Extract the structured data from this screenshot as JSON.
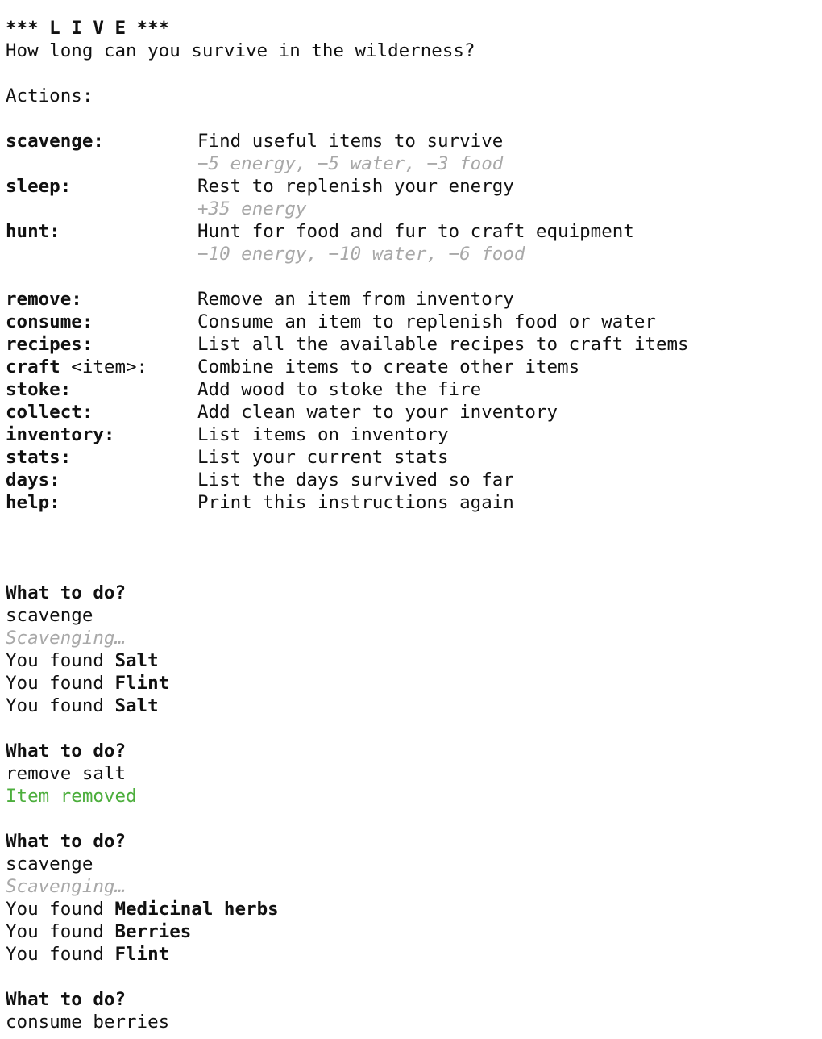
{
  "header": {
    "title": "*** L I V E ***",
    "subtitle": "How long can you survive in the wilderness?",
    "actions_label": "Actions:"
  },
  "actions_primary": [
    {
      "command": "scavenge:",
      "arg": "",
      "description": "Find useful items to survive",
      "cost": "−5 energy, −5 water, −3 food"
    },
    {
      "command": "sleep:",
      "arg": "",
      "description": "Rest to replenish your energy",
      "cost": "+35 energy"
    },
    {
      "command": "hunt:",
      "arg": "",
      "description": "Hunt for food and fur to craft equipment",
      "cost": "−10 energy, −10 water, −6 food"
    }
  ],
  "actions_secondary": [
    {
      "command": "remove:",
      "arg": "",
      "description": "Remove an item from inventory"
    },
    {
      "command": "consume:",
      "arg": "",
      "description": "Consume an item to replenish food or water"
    },
    {
      "command": "recipes:",
      "arg": "",
      "description": "List all the available recipes to craft items"
    },
    {
      "command": "craft",
      "arg": " <item>:",
      "description": "Combine items to create other items"
    },
    {
      "command": "stoke:",
      "arg": "",
      "description": "Add wood to stoke the fire"
    },
    {
      "command": "collect:",
      "arg": "",
      "description": "Add clean water to your inventory"
    },
    {
      "command": "inventory:",
      "arg": "",
      "description": "List items on inventory"
    },
    {
      "command": "stats:",
      "arg": "",
      "description": "List your current stats"
    },
    {
      "command": "days:",
      "arg": "",
      "description": "List the days survived so far"
    },
    {
      "command": "help:",
      "arg": "",
      "description": "Print this instructions again"
    }
  ],
  "log": {
    "prompt": "What to do?",
    "found_prefix": "You found ",
    "turns": [
      {
        "input": "scavenge",
        "status": "Scavenging…",
        "found": [
          "Salt",
          "Flint",
          "Salt"
        ]
      },
      {
        "input": "remove salt",
        "result": "Item removed"
      },
      {
        "input": "scavenge",
        "status": "Scavenging…",
        "found": [
          "Medicinal herbs",
          "Berries",
          "Flint"
        ]
      },
      {
        "input": "consume berries"
      }
    ]
  },
  "colors": {
    "text": "#111111",
    "muted": "#a8a8a8",
    "success": "#4cae3c",
    "background": "#ffffff"
  }
}
